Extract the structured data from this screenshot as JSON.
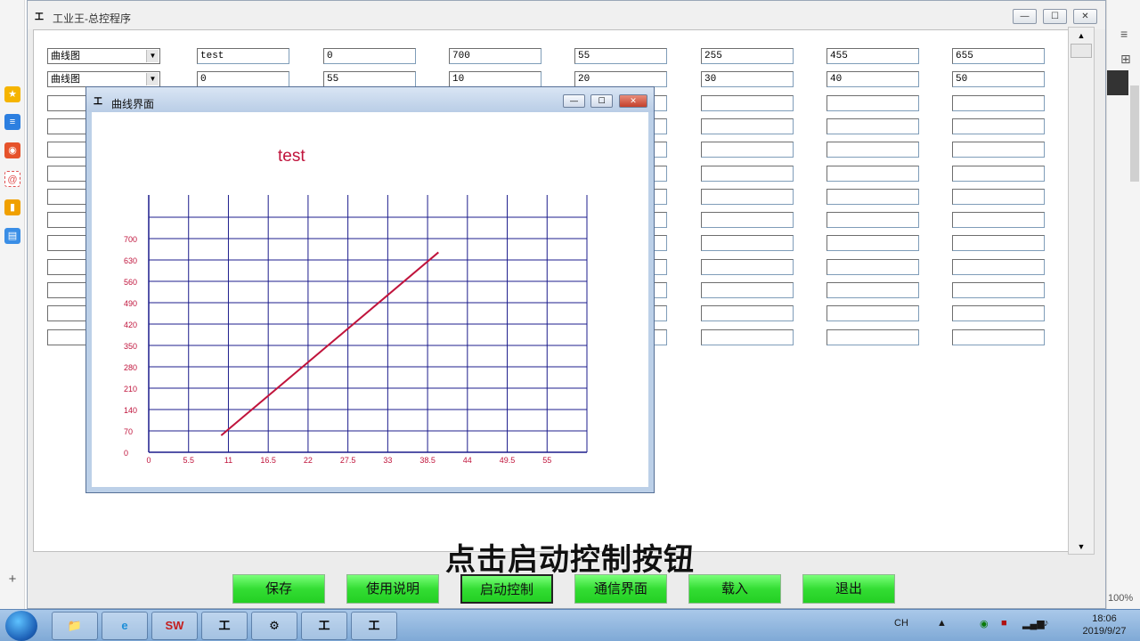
{
  "window": {
    "title": "工业王-总控程序",
    "icon_glyph": "工",
    "min_glyph": "—",
    "max_glyph": "☐",
    "close_glyph": "✕"
  },
  "grid": {
    "rows": [
      {
        "select": "曲线图",
        "cells": [
          "test",
          "0",
          "700",
          "55",
          "255",
          "455",
          "655"
        ]
      },
      {
        "select": "曲线图",
        "cells": [
          "0",
          "55",
          "10",
          "20",
          "30",
          "40",
          "50"
        ]
      }
    ],
    "empty_row_count": 11
  },
  "curve_window": {
    "title": "曲线界面",
    "icon_glyph": "工",
    "min_glyph": "—",
    "max_glyph": "☐",
    "close_glyph": "✕"
  },
  "chart_data": {
    "type": "line",
    "title": "test",
    "xlabel": "",
    "ylabel": "",
    "x_ticks": [
      0,
      5.5,
      11,
      16.5,
      22,
      27.5,
      33,
      38.5,
      44,
      49.5,
      55
    ],
    "y_ticks": [
      0,
      70,
      140,
      210,
      280,
      350,
      420,
      490,
      560,
      630,
      700
    ],
    "xlim": [
      0,
      55
    ],
    "ylim": [
      0,
      700
    ],
    "grid": true,
    "line_color": "#c0143c",
    "grid_color": "#1c1c8c",
    "series": [
      {
        "x": [
          10,
          40
        ],
        "y": [
          55,
          655
        ]
      }
    ]
  },
  "subtitle": "点击启动控制按钮",
  "buttons": [
    {
      "label": "保存"
    },
    {
      "label": "使用说明"
    },
    {
      "label": "启动控制"
    },
    {
      "label": "通信界面"
    },
    {
      "label": "载入"
    },
    {
      "label": "退出"
    }
  ],
  "taskbar": {
    "items": [
      "📁",
      "e",
      "SW",
      "工",
      "⚙",
      "工",
      "工"
    ],
    "tray": {
      "lang": "CH",
      "time": "18:06",
      "date": "2019/9/27"
    }
  },
  "browser": {
    "zoom": "100%"
  }
}
